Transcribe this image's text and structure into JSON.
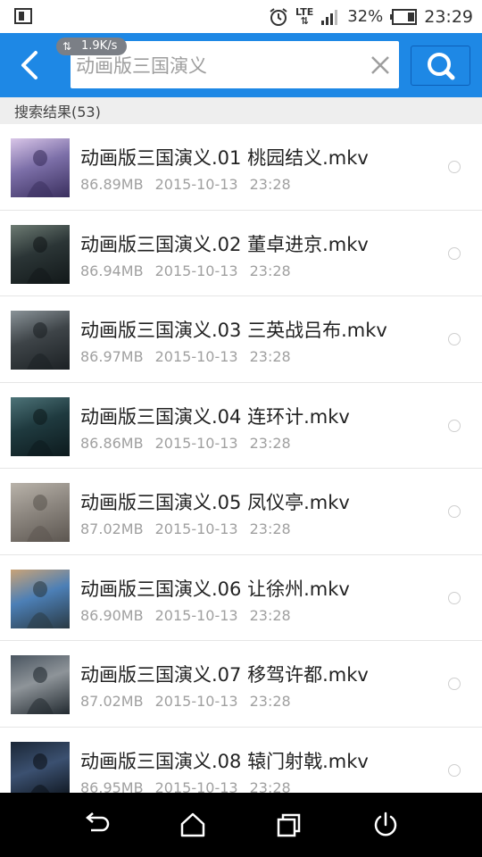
{
  "status_bar": {
    "network": "LTE",
    "battery": "32%",
    "time": "23:29",
    "icons": [
      "sim-icon",
      "alarm-icon",
      "lte-icon",
      "signal-icon",
      "battery-icon"
    ]
  },
  "header": {
    "speed_badge": "1.9K/s",
    "search_value": "动画版三国演义",
    "colors": {
      "accent": "#1e88e5",
      "accent_dark": "#0d5fb8"
    }
  },
  "results": {
    "label": "搜索结果(53)"
  },
  "list": {
    "items": [
      {
        "title": "动画版三国演义.01 桃园结义.mkv",
        "size": "86.89MB",
        "date": "2015-10-13",
        "time": "23:28",
        "thumb_palette": [
          "#7c6fa8",
          "#d9c6e8",
          "#3a2f5e"
        ]
      },
      {
        "title": "动画版三国演义.02 董卓进京.mkv",
        "size": "86.94MB",
        "date": "2015-10-13",
        "time": "23:28",
        "thumb_palette": [
          "#2b3536",
          "#6d7b73",
          "#121819"
        ]
      },
      {
        "title": "动画版三国演义.03 三英战吕布.mkv",
        "size": "86.97MB",
        "date": "2015-10-13",
        "time": "23:28",
        "thumb_palette": [
          "#3e4448",
          "#8a9398",
          "#1c2124"
        ]
      },
      {
        "title": "动画版三国演义.04 连环计.mkv",
        "size": "86.86MB",
        "date": "2015-10-13",
        "time": "23:28",
        "thumb_palette": [
          "#1f3a3f",
          "#4d7378",
          "#0d1a1d"
        ]
      },
      {
        "title": "动画版三国演义.05 凤仪亭.mkv",
        "size": "87.02MB",
        "date": "2015-10-13",
        "time": "23:28",
        "thumb_palette": [
          "#8d8780",
          "#b9b3aa",
          "#5c5650"
        ]
      },
      {
        "title": "动画版三国演义.06 让徐州.mkv",
        "size": "86.90MB",
        "date": "2015-10-13",
        "time": "23:28",
        "thumb_palette": [
          "#4c7fb6",
          "#c9a377",
          "#2a3a44"
        ]
      },
      {
        "title": "动画版三国演义.07 移驾许都.mkv",
        "size": "87.02MB",
        "date": "2015-10-13",
        "time": "23:28",
        "thumb_palette": [
          "#8e9499",
          "#4a5560",
          "#222a30"
        ]
      },
      {
        "title": "动画版三国演义.08 辕门射戟.mkv",
        "size": "86.95MB",
        "date": "2015-10-13",
        "time": "23:28",
        "thumb_palette": [
          "#3b5070",
          "#1b2736",
          "#0b1118"
        ]
      }
    ]
  },
  "nav_bar": {
    "icons": [
      "back-icon",
      "home-icon",
      "recent-apps-icon",
      "power-icon"
    ]
  }
}
